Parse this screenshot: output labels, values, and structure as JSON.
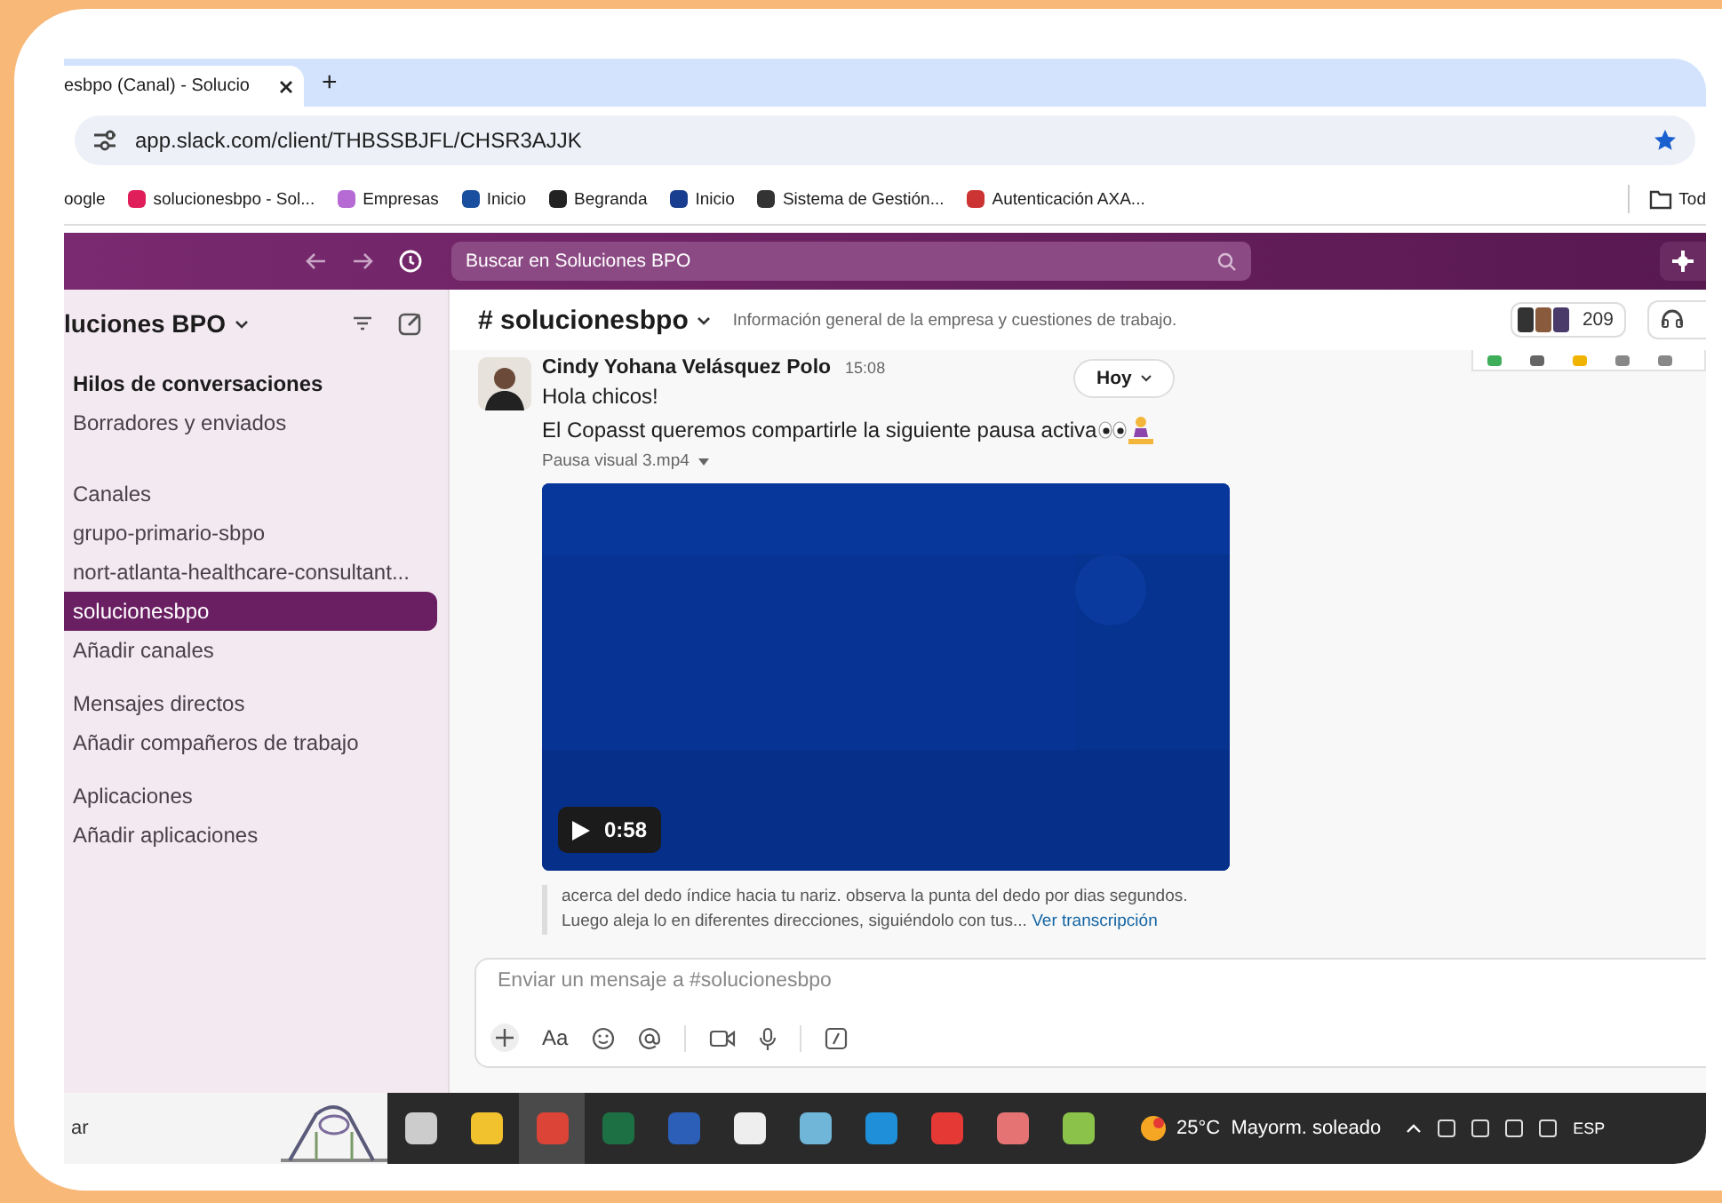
{
  "browser": {
    "tab_title": "esbpo (Canal) - Solucio",
    "new_tab": "+",
    "url": "app.slack.com/client/THBSSBJFL/CHSR3AJJK",
    "bookmarks": [
      {
        "label": "oogle"
      },
      {
        "label": "solucionesbpo - Sol..."
      },
      {
        "label": "Empresas"
      },
      {
        "label": "Inicio"
      },
      {
        "label": "Begranda"
      },
      {
        "label": "Inicio"
      },
      {
        "label": "Sistema de Gestión..."
      },
      {
        "label": "Autenticación AXA..."
      }
    ],
    "folder": "Tod"
  },
  "slack": {
    "search_placeholder": "Buscar en Soluciones BPO",
    "workspace": "luciones BPO",
    "sidebar": [
      {
        "label": "Hilos de conversaciones",
        "kind": "bold",
        "selected": false
      },
      {
        "label": "Borradores y enviados",
        "kind": "item",
        "selected": false
      },
      {
        "label": "Canales",
        "kind": "header",
        "selected": false
      },
      {
        "label": "grupo-primario-sbpo",
        "kind": "item",
        "selected": false
      },
      {
        "label": "nort-atlanta-healthcare-consultant...",
        "kind": "item",
        "selected": false
      },
      {
        "label": "solucionesbpo",
        "kind": "item",
        "selected": true
      },
      {
        "label": "Añadir canales",
        "kind": "item",
        "selected": false
      },
      {
        "label": "Mensajes directos",
        "kind": "header",
        "selected": false
      },
      {
        "label": "Añadir compañeros de trabajo",
        "kind": "item",
        "selected": false
      },
      {
        "label": "Aplicaciones",
        "kind": "header",
        "selected": false
      },
      {
        "label": "Añadir aplicaciones",
        "kind": "item",
        "selected": false
      }
    ],
    "channel": {
      "name": "# solucionesbpo",
      "description": "Información general de la empresa y cuestiones de trabajo.",
      "member_count": "209"
    },
    "message": {
      "author": "Cindy Yohana Velásquez Polo",
      "time": "15:08",
      "day_button": "Hoy",
      "lines": [
        "Hola chicos!",
        "El Copasst queremos compartirle la siguiente pausa activa"
      ],
      "attachment": "Pausa visual 3.mp4",
      "duration": "0:58",
      "transcript": "acerca del dedo índice hacia tu nariz. observa la punta del dedo por dias segundos. Luego aleja lo en diferentes direcciones, siguiéndolo con tus...",
      "transcript_link": "Ver transcripción"
    },
    "composer": {
      "placeholder": "Enviar un mensaje a #solucionesbpo",
      "format_label": "Aa"
    }
  },
  "taskbar": {
    "search": "ar",
    "apps": [
      {
        "selected": false
      },
      {
        "selected": false
      },
      {
        "selected": true
      },
      {
        "selected": false
      },
      {
        "selected": false
      },
      {
        "selected": false
      },
      {
        "selected": false
      },
      {
        "selected": false
      },
      {
        "selected": false
      },
      {
        "selected": false
      },
      {
        "selected": false
      }
    ],
    "weather": "25°C  Mayorm. soleado",
    "language": "ESP"
  }
}
